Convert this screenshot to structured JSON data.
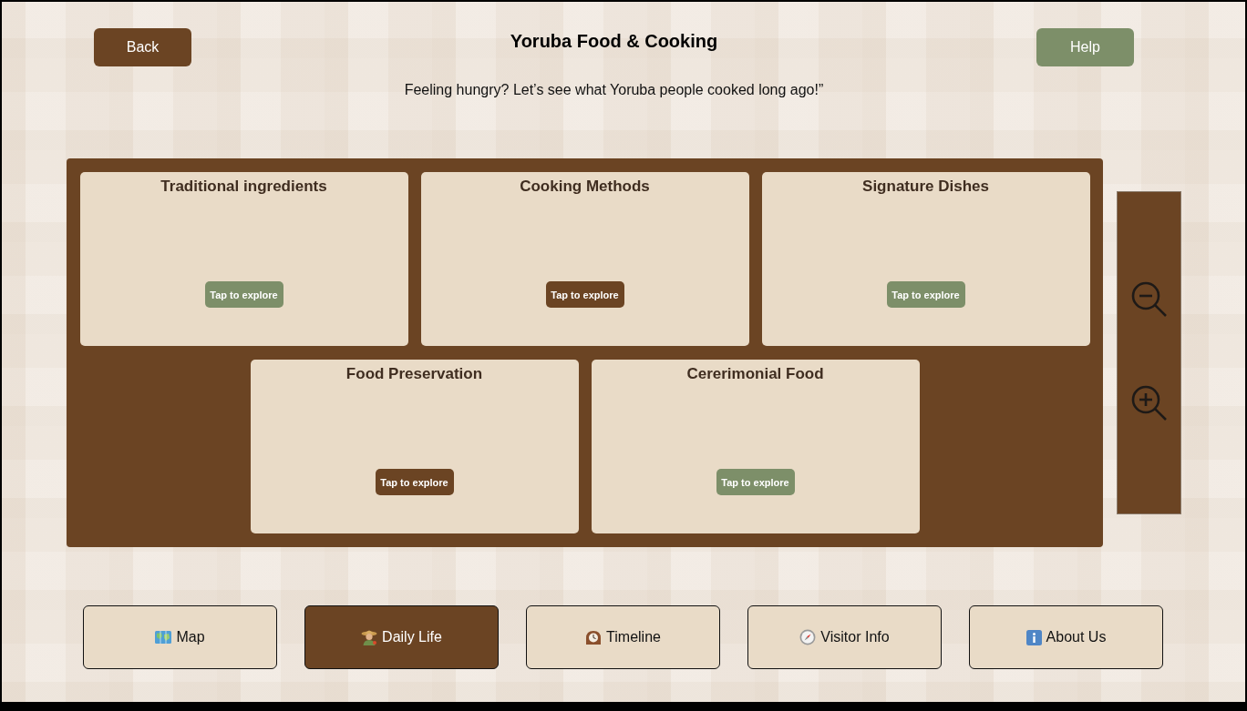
{
  "header": {
    "back_button": "Back",
    "title": "Yoruba Food & Cooking",
    "help_button": "Help",
    "subtitle": "Feeling hungry? Let’s see what Yoruba people cooked long ago!”"
  },
  "categories": [
    {
      "title": "Traditional ingredients",
      "button": "Tap to explore",
      "color": "#7d8f69"
    },
    {
      "title": "Cooking Methods",
      "button": "Tap to explore",
      "color": "#6b4423"
    },
    {
      "title": "Signature Dishes",
      "button": "Tap to explore",
      "color": "#7d8f69"
    },
    {
      "title": "Food Preservation",
      "button": "Tap to explore",
      "color": "#6b4423"
    },
    {
      "title": "Cererimonial Food",
      "button": "Tap to explore",
      "color": "#7d8f69"
    }
  ],
  "nav": [
    {
      "label": "Map",
      "selected": false
    },
    {
      "label": "Daily Life",
      "selected": true
    },
    {
      "label": "Timeline",
      "selected": false
    },
    {
      "label": "Visitor Info",
      "selected": false
    },
    {
      "label": "About Us",
      "selected": false
    }
  ]
}
